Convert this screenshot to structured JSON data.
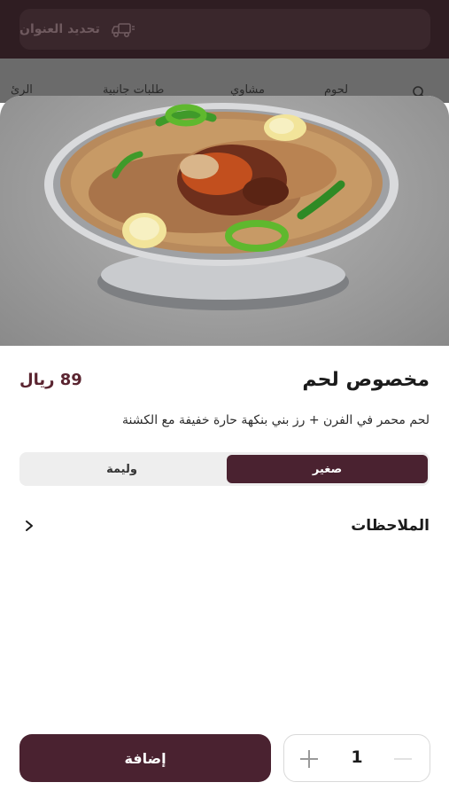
{
  "header": {
    "address_label": "تحديد العنوان",
    "tab_hints": [
      "الرئ",
      "طلبات جانبية",
      "مشاوي",
      "لحوم"
    ]
  },
  "product": {
    "title": "مخصوص لحم",
    "price": "89 ريال",
    "description": "لحم محمر في الفرن + رز بني بنكهة حارة خفيفة مع الكشنة"
  },
  "sizes": {
    "selected": "صغير",
    "other": "وليمة"
  },
  "notes": {
    "label": "الملاحظات"
  },
  "cart": {
    "add_label": "إضافة",
    "quantity": "1"
  },
  "colors": {
    "brand": "#4a2230",
    "header_bg": "#2f1d22"
  }
}
